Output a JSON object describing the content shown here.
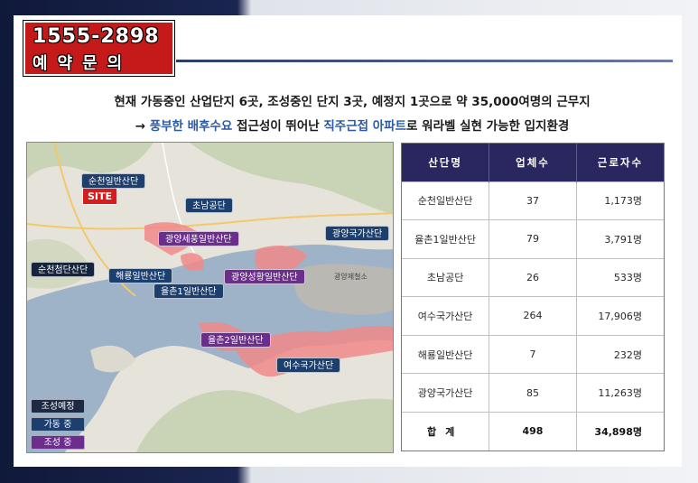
{
  "promo": {
    "phone": "1555-2898",
    "caption": "예약문의"
  },
  "headline": {
    "line1": "현재 가동중인 산업단지 6곳, 조성중인 단지 3곳, 예정지 1곳으로 약 35,000여명의 근무지",
    "line2_prefix": "→ ",
    "line2_accent1": "풍부한 배후수요",
    "line2_mid": " 접근성이 뛰어난 ",
    "line2_accent2": "직주근접 아파트",
    "line2_suffix": "로 워라벨 실현 가능한 입지환경"
  },
  "map": {
    "site_label": "SITE",
    "labels": {
      "suncheon_general": "순천일반산단",
      "chonam": "초남공단",
      "gwangyang_national": "광양국가산단",
      "gwangyang_sepung": "광양세풍일반산단",
      "suncheon_cheomdan": "순천첨단산단",
      "haeryong": "해룡일반산단",
      "gwangyang_seonghwang": "광양성황일반산단",
      "yulchon1": "율촌1일반산단",
      "yulchon2": "율촌2일반산단",
      "yeosu_national": "여수국가산단"
    },
    "place_labels": {
      "steelworks": "광양제철소"
    },
    "legend": [
      {
        "label": "조성예정",
        "color": "#1c2a44"
      },
      {
        "label": "가동 중",
        "color": "#1c3f6e"
      },
      {
        "label": "조성 중",
        "color": "#6b2e8c"
      }
    ],
    "colors": {
      "sea": "#9eb3c7",
      "land": "#e6e3da",
      "hills": "#c9d3b6",
      "industrial": "#f08a8a"
    }
  },
  "table": {
    "headers": [
      "산단명",
      "업체수",
      "근로자수"
    ],
    "rows": [
      {
        "name": "순천일반산단",
        "count": "37",
        "workers": "1,173명"
      },
      {
        "name": "율촌1일반산단",
        "count": "79",
        "workers": "3,791명"
      },
      {
        "name": "초남공단",
        "count": "26",
        "workers": "533명"
      },
      {
        "name": "여수국가산단",
        "count": "264",
        "workers": "17,906명"
      },
      {
        "name": "해룡일반산단",
        "count": "7",
        "workers": "232명"
      },
      {
        "name": "광양국가산단",
        "count": "85",
        "workers": "11,263명"
      }
    ],
    "total": {
      "label": "합계",
      "count": "498",
      "workers": "34,898명"
    }
  }
}
